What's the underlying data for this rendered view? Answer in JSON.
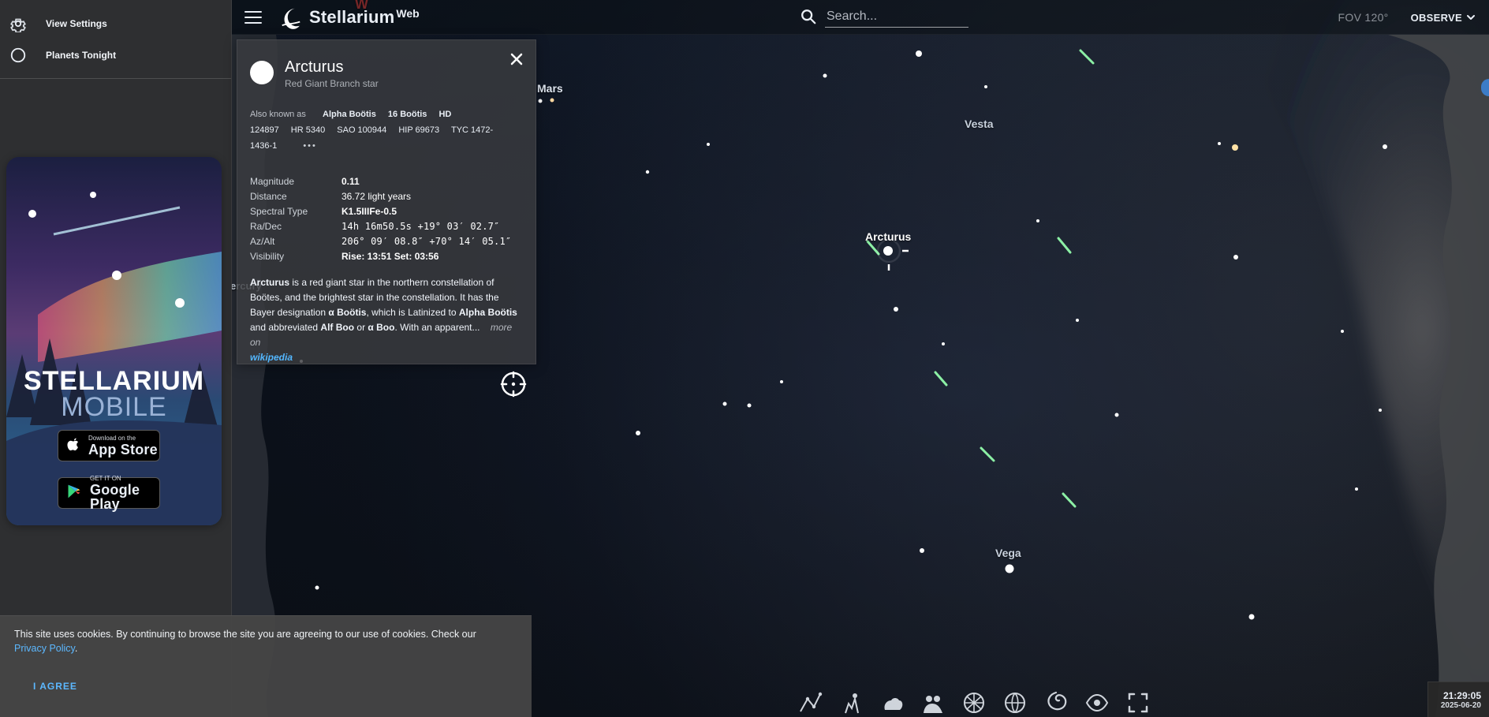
{
  "app": {
    "title": "Stellarium",
    "title_sup": "Web"
  },
  "topbar": {
    "search_placeholder": "Search...",
    "fov": "FOV 120°",
    "observe": "OBSERVE"
  },
  "sidebar": {
    "items": [
      {
        "label": "View Settings",
        "icon": "gear-icon"
      },
      {
        "label": "Planets Tonight",
        "icon": "circle-icon"
      }
    ],
    "promo": {
      "title": "STELLARIUM",
      "subtitle": "MOBILE",
      "appstore_small": "Download on the",
      "appstore_big": "App Store",
      "google_small": "GET IT ON",
      "google_big": "Google Play"
    }
  },
  "sky": {
    "labels": [
      {
        "text": "Mars"
      },
      {
        "text": "Vesta"
      },
      {
        "text": "Arcturus"
      },
      {
        "text": "Vega"
      },
      {
        "text": "ercury"
      },
      {
        "text": "W"
      }
    ]
  },
  "info": {
    "name": "Arcturus",
    "type": "Red Giant Branch star",
    "aka_label": "Also known as",
    "aka": [
      {
        "text": "Alpha Boötis",
        "bold": true
      },
      {
        "text": "16 Boötis",
        "bold": true
      },
      {
        "text": "HD",
        "bold": true
      },
      {
        "text": "124897",
        "bold": false
      },
      {
        "text": "HR 5340",
        "bold": false
      },
      {
        "text": "SAO 100944",
        "bold": false
      },
      {
        "text": "HIP 69673",
        "bold": false
      },
      {
        "text": "TYC 1472-",
        "bold": false
      },
      {
        "text": "1436-1",
        "bold": false
      }
    ],
    "aka_more": "•••",
    "properties": [
      {
        "k": "Magnitude",
        "v": "0.11"
      },
      {
        "k": "Distance",
        "v": "36.72 light years"
      },
      {
        "k": "Spectral Type",
        "v": "K1.5IIIFe-0.5"
      },
      {
        "k": "Ra/Dec",
        "v": "14h 16m50.5s  +19° 03′ 02.7″"
      },
      {
        "k": "Az/Alt",
        "v": "206° 09′ 08.8″  +70° 14′ 05.1″"
      },
      {
        "k": "Visibility",
        "v": "Rise: 13:51   Set: 03:56"
      }
    ],
    "description_parts": [
      {
        "text": "Arcturus",
        "b": true
      },
      {
        "text": " is a red giant star in the northern constellation of Boötes, and the brightest star in the constellation. It has the Bayer designation ",
        "b": false
      },
      {
        "text": "α Boötis",
        "b": true
      },
      {
        "text": ", which is Latinized to ",
        "b": false
      },
      {
        "text": "Alpha Boötis",
        "b": true
      },
      {
        "text": " and abbreviated ",
        "b": false
      },
      {
        "text": "Alf Boo",
        "b": true
      },
      {
        "text": " or ",
        "b": false
      },
      {
        "text": "α Boo",
        "b": true
      },
      {
        "text": ". With an apparent...",
        "b": false
      }
    ],
    "more_on": "more on",
    "wikipedia": "wikipedia"
  },
  "cookie": {
    "text_prefix": "This site uses cookies. By continuing to browse the site you are agreeing to our use of cookies. Check our",
    "link": "Privacy Policy",
    "text_suffix": ".",
    "button": "I AGREE"
  },
  "bottom_tools": [
    {
      "name": "constellation-lines-icon"
    },
    {
      "name": "constellation-art-icon"
    },
    {
      "name": "atmosphere-icon"
    },
    {
      "name": "landscape-icon"
    },
    {
      "name": "azimuthal-grid-icon"
    },
    {
      "name": "equatorial-grid-icon"
    },
    {
      "name": "deep-sky-icon"
    },
    {
      "name": "night-mode-icon"
    },
    {
      "name": "fullscreen-icon"
    }
  ],
  "time": {
    "time": "21:29:05",
    "date": "2025-06-20"
  },
  "colors": {
    "accent": "#37a3ff",
    "panel": "#2e2f31",
    "sky": "#0c111a"
  }
}
